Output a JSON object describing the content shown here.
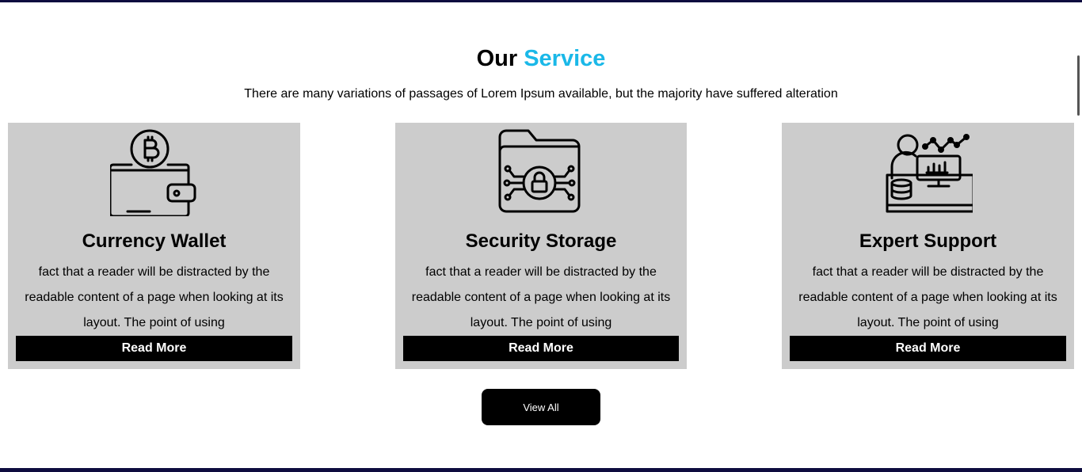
{
  "section": {
    "title_prefix": "Our",
    "title_accent": "Service",
    "subtitle": "There are many variations of passages of Lorem Ipsum available, but the majority have suffered alteration",
    "accent_color": "#1ab8e8"
  },
  "cards": [
    {
      "icon": "bitcoin-wallet-icon",
      "title": "Currency Wallet",
      "text": "fact that a reader will be distracted by the readable content of a page when looking at its layout. The point of using",
      "button": "Read More"
    },
    {
      "icon": "secure-folder-icon",
      "title": "Security Storage",
      "text": "fact that a reader will be distracted by the readable content of a page when looking at its layout. The point of using",
      "button": "Read More"
    },
    {
      "icon": "expert-support-icon",
      "title": "Expert Support",
      "text": "fact that a reader will be distracted by the readable content of a page when looking at its layout. The point of using",
      "button": "Read More"
    }
  ],
  "view_all": "View All"
}
